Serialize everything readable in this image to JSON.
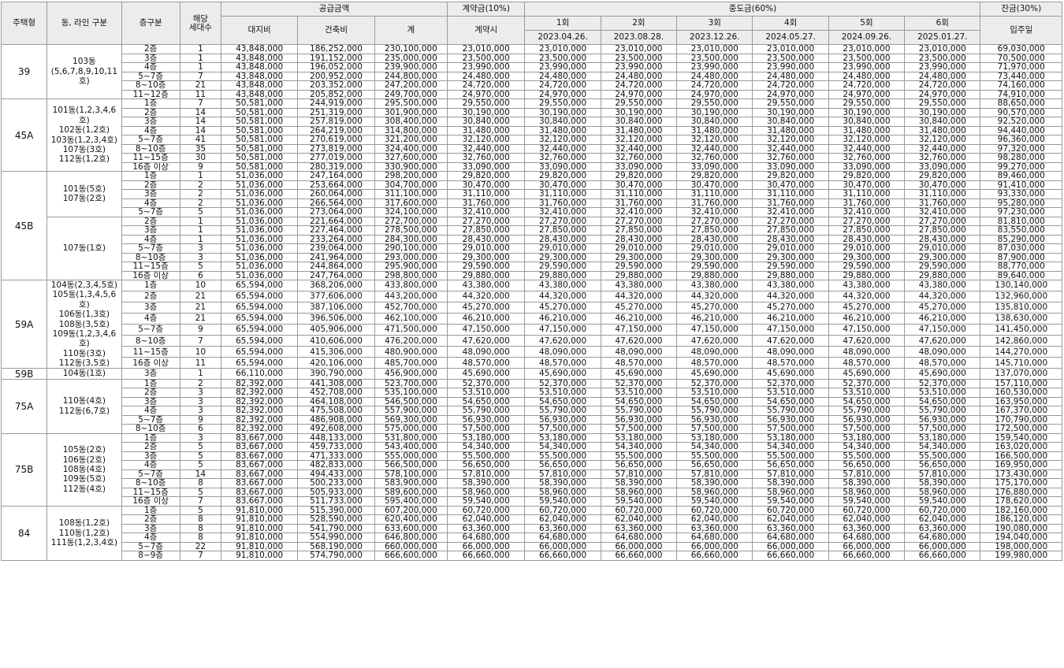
{
  "headers": {
    "type": "주택형",
    "line": "동, 라인 구분",
    "floor": "층구분",
    "units_l1": "해당",
    "units_l2": "세대수",
    "supply": "공급금액",
    "land": "대지비",
    "building": "건축비",
    "total": "계",
    "deposit": "계약금(10%)",
    "deposit_sub": "계약시",
    "middle": "중도금(60%)",
    "balance": "잔금(30%)",
    "balance_sub": "입주일",
    "installments": [
      {
        "label": "1회",
        "date": "2023.04.26."
      },
      {
        "label": "2회",
        "date": "2023.08.28."
      },
      {
        "label": "3회",
        "date": "2023.12.26."
      },
      {
        "label": "4회",
        "date": "2024.05.27."
      },
      {
        "label": "5회",
        "date": "2024.09.26."
      },
      {
        "label": "6회",
        "date": "2025.01.27."
      }
    ]
  },
  "groups": [
    {
      "type": "39",
      "lines": [
        {
          "text": "103동\n(5,6,7,8,9,10,11호)",
          "rows": [
            [
              "2층",
              "1",
              "43,848,000",
              "186,252,000",
              "230,100,000",
              "23,010,000",
              "23,010,000",
              "69,030,000"
            ],
            [
              "3층",
              "1",
              "43,848,000",
              "191,152,000",
              "235,000,000",
              "23,500,000",
              "23,500,000",
              "70,500,000"
            ],
            [
              "4층",
              "1",
              "43,848,000",
              "196,052,000",
              "239,900,000",
              "23,990,000",
              "23,990,000",
              "71,970,000"
            ],
            [
              "5~7층",
              "7",
              "43,848,000",
              "200,952,000",
              "244,800,000",
              "24,480,000",
              "24,480,000",
              "73,440,000"
            ],
            [
              "8~10층",
              "21",
              "43,848,000",
              "203,352,000",
              "247,200,000",
              "24,720,000",
              "24,720,000",
              "74,160,000"
            ],
            [
              "11~12층",
              "11",
              "43,848,000",
              "205,852,000",
              "249,700,000",
              "24,970,000",
              "24,970,000",
              "74,910,000"
            ]
          ]
        }
      ]
    },
    {
      "type": "45A",
      "lines": [
        {
          "text": "101동(1,2,3,4,6호)\n102동(1,2호)\n103동(1,2,3,4호)\n107동(3호)\n112동(1,2호)",
          "rows": [
            [
              "1층",
              "7",
              "50,581,000",
              "244,919,000",
              "295,500,000",
              "29,550,000",
              "29,550,000",
              "88,650,000"
            ],
            [
              "2층",
              "14",
              "50,581,000",
              "251,319,000",
              "301,900,000",
              "30,190,000",
              "30,190,000",
              "90,570,000"
            ],
            [
              "3층",
              "14",
              "50,581,000",
              "257,819,000",
              "308,400,000",
              "30,840,000",
              "30,840,000",
              "92,520,000"
            ],
            [
              "4층",
              "14",
              "50,581,000",
              "264,219,000",
              "314,800,000",
              "31,480,000",
              "31,480,000",
              "94,440,000"
            ],
            [
              "5~7층",
              "41",
              "50,581,000",
              "270,619,000",
              "321,200,000",
              "32,120,000",
              "32,120,000",
              "96,360,000"
            ],
            [
              "8~10층",
              "35",
              "50,581,000",
              "273,819,000",
              "324,400,000",
              "32,440,000",
              "32,440,000",
              "97,320,000"
            ],
            [
              "11~15층",
              "30",
              "50,581,000",
              "277,019,000",
              "327,600,000",
              "32,760,000",
              "32,760,000",
              "98,280,000"
            ],
            [
              "16층 이상",
              "9",
              "50,581,000",
              "280,319,000",
              "330,900,000",
              "33,090,000",
              "33,090,000",
              "99,270,000"
            ]
          ]
        }
      ]
    },
    {
      "type": "45B",
      "lines": [
        {
          "text": "101동(5호)\n107동(2호)",
          "rows": [
            [
              "1층",
              "1",
              "51,036,000",
              "247,164,000",
              "298,200,000",
              "29,820,000",
              "29,820,000",
              "89,460,000"
            ],
            [
              "2층",
              "2",
              "51,036,000",
              "253,664,000",
              "304,700,000",
              "30,470,000",
              "30,470,000",
              "91,410,000"
            ],
            [
              "3층",
              "2",
              "51,036,000",
              "260,064,000",
              "311,100,000",
              "31,110,000",
              "31,110,000",
              "93,330,000"
            ],
            [
              "4층",
              "2",
              "51,036,000",
              "266,564,000",
              "317,600,000",
              "31,760,000",
              "31,760,000",
              "95,280,000"
            ],
            [
              "5~7층",
              "5",
              "51,036,000",
              "273,064,000",
              "324,100,000",
              "32,410,000",
              "32,410,000",
              "97,230,000"
            ]
          ]
        },
        {
          "text": "107동(1호)",
          "rows": [
            [
              "2층",
              "1",
              "51,036,000",
              "221,664,000",
              "272,700,000",
              "27,270,000",
              "27,270,000",
              "81,810,000"
            ],
            [
              "3층",
              "1",
              "51,036,000",
              "227,464,000",
              "278,500,000",
              "27,850,000",
              "27,850,000",
              "83,550,000"
            ],
            [
              "4층",
              "1",
              "51,036,000",
              "233,264,000",
              "284,300,000",
              "28,430,000",
              "28,430,000",
              "85,290,000"
            ],
            [
              "5~7층",
              "3",
              "51,036,000",
              "239,064,000",
              "290,100,000",
              "29,010,000",
              "29,010,000",
              "87,030,000"
            ],
            [
              "8~10층",
              "3",
              "51,036,000",
              "241,964,000",
              "293,000,000",
              "29,300,000",
              "29,300,000",
              "87,900,000"
            ],
            [
              "11~15층",
              "5",
              "51,036,000",
              "244,864,000",
              "295,900,000",
              "29,590,000",
              "29,590,000",
              "88,770,000"
            ],
            [
              "16층 이상",
              "6",
              "51,036,000",
              "247,764,000",
              "298,800,000",
              "29,880,000",
              "29,880,000",
              "89,640,000"
            ]
          ]
        }
      ]
    },
    {
      "type": "59A",
      "lines": [
        {
          "text": "104동(2,3,4,5호)\n105동(1,3,4,5,6호)\n106동(1,3호)\n108동(3,5호)\n109동(1,2,3,4,6호)\n110동(3호)\n112동(3,5호)",
          "rows": [
            [
              "1층",
              "10",
              "65,594,000",
              "368,206,000",
              "433,800,000",
              "43,380,000",
              "43,380,000",
              "130,140,000"
            ],
            [
              "2층",
              "21",
              "65,594,000",
              "377,606,000",
              "443,200,000",
              "44,320,000",
              "44,320,000",
              "132,960,000"
            ],
            [
              "3층",
              "21",
              "65,594,000",
              "387,106,000",
              "452,700,000",
              "45,270,000",
              "45,270,000",
              "135,810,000"
            ],
            [
              "4층",
              "21",
              "65,594,000",
              "396,506,000",
              "462,100,000",
              "46,210,000",
              "46,210,000",
              "138,630,000"
            ],
            [
              "5~7층",
              "9",
              "65,594,000",
              "405,906,000",
              "471,500,000",
              "47,150,000",
              "47,150,000",
              "141,450,000"
            ],
            [
              "8~10층",
              "7",
              "65,594,000",
              "410,606,000",
              "476,200,000",
              "47,620,000",
              "47,620,000",
              "142,860,000"
            ],
            [
              "11~15층",
              "10",
              "65,594,000",
              "415,306,000",
              "480,900,000",
              "48,090,000",
              "48,090,000",
              "144,270,000"
            ],
            [
              "16층 이상",
              "11",
              "65,594,000",
              "420,106,000",
              "485,700,000",
              "48,570,000",
              "48,570,000",
              "145,710,000"
            ]
          ]
        }
      ]
    },
    {
      "type": "59B",
      "lines": [
        {
          "text": "104동(1호)",
          "rows": [
            [
              "3층",
              "1",
              "66,110,000",
              "390,790,000",
              "456,900,000",
              "45,690,000",
              "45,690,000",
              "137,070,000"
            ]
          ]
        }
      ]
    },
    {
      "type": "75A",
      "lines": [
        {
          "text": "110동(4호)\n112동(6,7호)",
          "rows": [
            [
              "1층",
              "2",
              "82,392,000",
              "441,308,000",
              "523,700,000",
              "52,370,000",
              "52,370,000",
              "157,110,000"
            ],
            [
              "2층",
              "3",
              "82,392,000",
              "452,708,000",
              "535,100,000",
              "53,510,000",
              "53,510,000",
              "160,530,000"
            ],
            [
              "3층",
              "3",
              "82,392,000",
              "464,108,000",
              "546,500,000",
              "54,650,000",
              "54,650,000",
              "163,950,000"
            ],
            [
              "4층",
              "3",
              "82,392,000",
              "475,508,000",
              "557,900,000",
              "55,790,000",
              "55,790,000",
              "167,370,000"
            ],
            [
              "5~7층",
              "9",
              "82,392,000",
              "486,908,000",
              "569,300,000",
              "56,930,000",
              "56,930,000",
              "170,790,000"
            ],
            [
              "8~10층",
              "6",
              "82,392,000",
              "492,608,000",
              "575,000,000",
              "57,500,000",
              "57,500,000",
              "172,500,000"
            ]
          ]
        }
      ]
    },
    {
      "type": "75B",
      "lines": [
        {
          "text": "105동(2호)\n106동(2호)\n108동(4호)\n109동(5호)\n112동(4호)",
          "rows": [
            [
              "1층",
              "3",
              "83,667,000",
              "448,133,000",
              "531,800,000",
              "53,180,000",
              "53,180,000",
              "159,540,000"
            ],
            [
              "2층",
              "5",
              "83,667,000",
              "459,733,000",
              "543,400,000",
              "54,340,000",
              "54,340,000",
              "163,020,000"
            ],
            [
              "3층",
              "5",
              "83,667,000",
              "471,333,000",
              "555,000,000",
              "55,500,000",
              "55,500,000",
              "166,500,000"
            ],
            [
              "4층",
              "5",
              "83,667,000",
              "482,833,000",
              "566,500,000",
              "56,650,000",
              "56,650,000",
              "169,950,000"
            ],
            [
              "5~7층",
              "14",
              "83,667,000",
              "494,433,000",
              "578,100,000",
              "57,810,000",
              "57,810,000",
              "173,430,000"
            ],
            [
              "8~10층",
              "8",
              "83,667,000",
              "500,233,000",
              "583,900,000",
              "58,390,000",
              "58,390,000",
              "175,170,000"
            ],
            [
              "11~15층",
              "5",
              "83,667,000",
              "505,933,000",
              "589,600,000",
              "58,960,000",
              "58,960,000",
              "176,880,000"
            ],
            [
              "16층 이상",
              "7",
              "83,667,000",
              "511,733,000",
              "595,400,000",
              "59,540,000",
              "59,540,000",
              "178,620,000"
            ]
          ]
        }
      ]
    },
    {
      "type": "84",
      "lines": [
        {
          "text": "108동(1,2호)\n110동(1,2호)\n111동(1,2,3,4호)",
          "rows": [
            [
              "1층",
              "5",
              "91,810,000",
              "515,390,000",
              "607,200,000",
              "60,720,000",
              "60,720,000",
              "182,160,000"
            ],
            [
              "2층",
              "8",
              "91,810,000",
              "528,590,000",
              "620,400,000",
              "62,040,000",
              "62,040,000",
              "186,120,000"
            ],
            [
              "3층",
              "8",
              "91,810,000",
              "541,790,000",
              "633,600,000",
              "63,360,000",
              "63,360,000",
              "190,080,000"
            ],
            [
              "4층",
              "8",
              "91,810,000",
              "554,990,000",
              "646,800,000",
              "64,680,000",
              "64,680,000",
              "194,040,000"
            ],
            [
              "5~7층",
              "22",
              "91,810,000",
              "568,190,000",
              "660,000,000",
              "66,000,000",
              "66,000,000",
              "198,000,000"
            ],
            [
              "8~9층",
              "7",
              "91,810,000",
              "574,790,000",
              "666,600,000",
              "66,660,000",
              "66,660,000",
              "199,980,000"
            ]
          ]
        }
      ]
    }
  ]
}
